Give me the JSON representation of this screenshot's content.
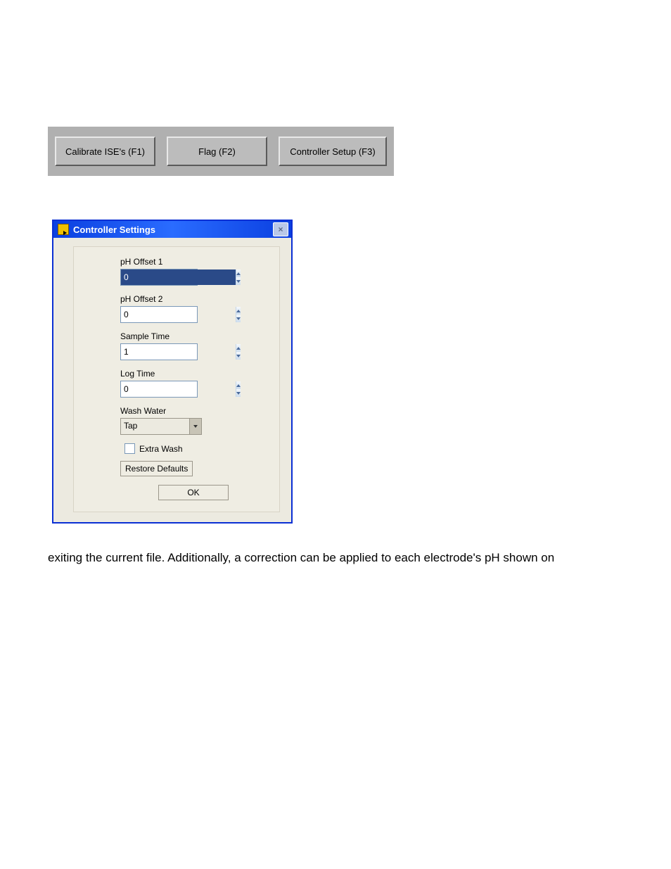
{
  "toolbar": {
    "calibrate_label": "Calibrate ISE's (F1)",
    "flag_label": "Flag (F2)",
    "controller_setup_label": "Controller Setup (F3)"
  },
  "dialog": {
    "title": "Controller Settings",
    "close_glyph": "×",
    "fields": {
      "ph_offset_1": {
        "label": "pH Offset 1",
        "value": "0"
      },
      "ph_offset_2": {
        "label": "pH Offset 2",
        "value": "0"
      },
      "sample_time": {
        "label": "Sample Time",
        "value": "1"
      },
      "log_time": {
        "label": "Log Time",
        "value": "0"
      },
      "wash_water": {
        "label": "Wash Water",
        "value": "Tap"
      }
    },
    "extra_wash_label": "Extra Wash",
    "restore_defaults_label": "Restore Defaults",
    "ok_label": "OK"
  },
  "body_text": "exiting the current file.  Additionally, a correction can be applied to each electrode's pH shown on"
}
